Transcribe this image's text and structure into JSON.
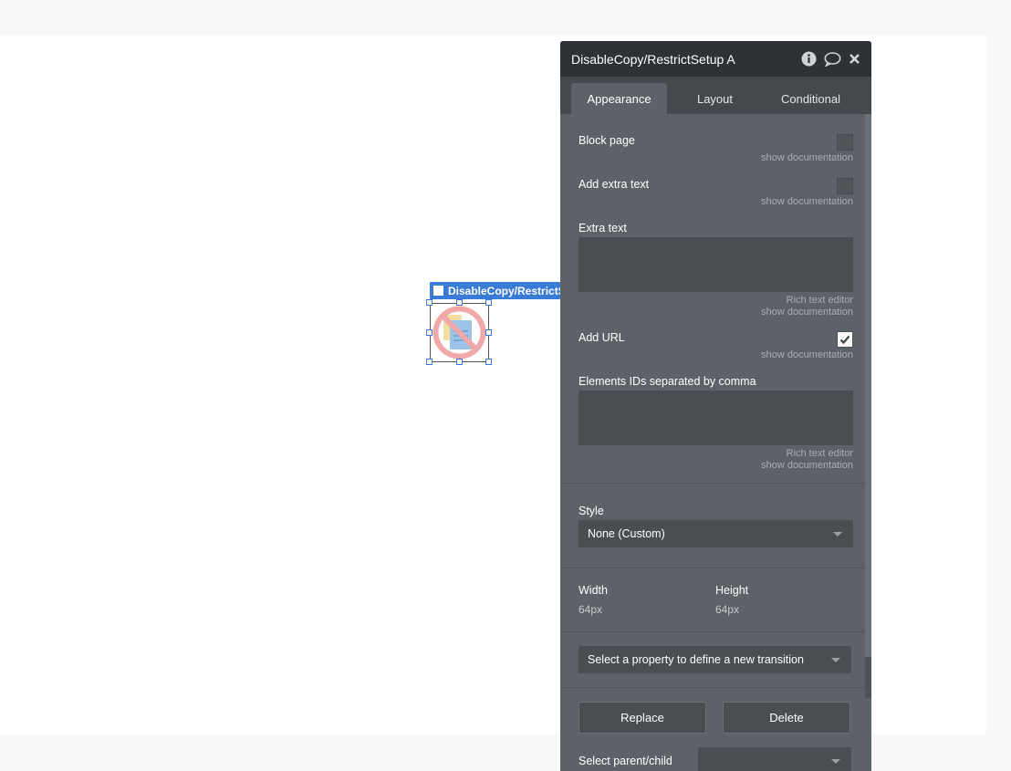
{
  "canvas": {
    "element_tag": "DisableCopy/RestrictSetup A"
  },
  "panel": {
    "title": "DisableCopy/RestrictSetup A",
    "tabs": [
      {
        "label": "Appearance",
        "active": true
      },
      {
        "label": "Layout",
        "active": false
      },
      {
        "label": "Conditional",
        "active": false
      }
    ],
    "fields": {
      "block_page": {
        "label": "Block page",
        "checked": false,
        "doc": "show documentation"
      },
      "add_extra_text": {
        "label": "Add extra text",
        "checked": false,
        "doc": "show documentation"
      },
      "extra_text": {
        "label": "Extra text",
        "value": "",
        "rich": "Rich text editor",
        "doc": "show documentation"
      },
      "add_url": {
        "label": "Add URL",
        "checked": true,
        "doc": "show documentation"
      },
      "element_ids": {
        "label": "Elements IDs separated by comma",
        "value": "",
        "rich": "Rich text editor",
        "doc": "show documentation"
      }
    },
    "style": {
      "label": "Style",
      "value": "None (Custom)"
    },
    "size": {
      "width_label": "Width",
      "width_value": "64px",
      "height_label": "Height",
      "height_value": "64px"
    },
    "transition": {
      "placeholder": "Select a property to define a new transition"
    },
    "buttons": {
      "replace": "Replace",
      "delete": "Delete"
    },
    "parent_child": {
      "label": "Select parent/child"
    }
  },
  "colors": {
    "panel_bg": "#5d6268",
    "header_bg": "#2e3236",
    "accent": "#3a7bd5"
  }
}
